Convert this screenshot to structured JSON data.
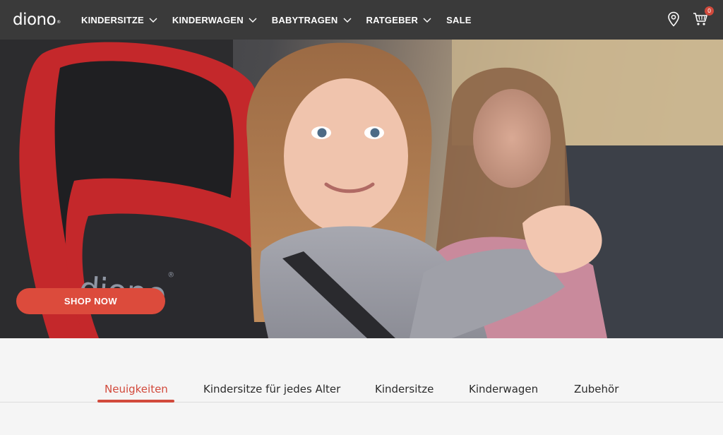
{
  "brand": {
    "logo_text": "diono",
    "logo_mark": "®"
  },
  "nav": {
    "items": [
      {
        "label": "KINDERSITZE",
        "has_dropdown": true
      },
      {
        "label": "KINDERWAGEN",
        "has_dropdown": true
      },
      {
        "label": "BABYTRAGEN",
        "has_dropdown": true
      },
      {
        "label": "RATGEBER",
        "has_dropdown": true
      },
      {
        "label": "SALE",
        "has_dropdown": false
      }
    ]
  },
  "header_icons": {
    "location": "location-pin-icon",
    "cart": "cart-icon",
    "cart_count": "0"
  },
  "hero": {
    "image": "hero-image-girl-in-car-seat",
    "seat_logo_text": "diono",
    "seat_logo_mark": "®",
    "cta_label": "SHOP NOW"
  },
  "tabs": {
    "items": [
      {
        "label": "Neuigkeiten",
        "active": true
      },
      {
        "label": "Kindersitze für jedes Alter",
        "active": false
      },
      {
        "label": "Kindersitze",
        "active": false
      },
      {
        "label": "Kinderwagen",
        "active": false
      },
      {
        "label": "Zubehör",
        "active": false
      }
    ]
  },
  "colors": {
    "header_bg": "#3a3a3a",
    "accent": "#dc4b3c",
    "tabs_bg": "#f5f5f5"
  }
}
